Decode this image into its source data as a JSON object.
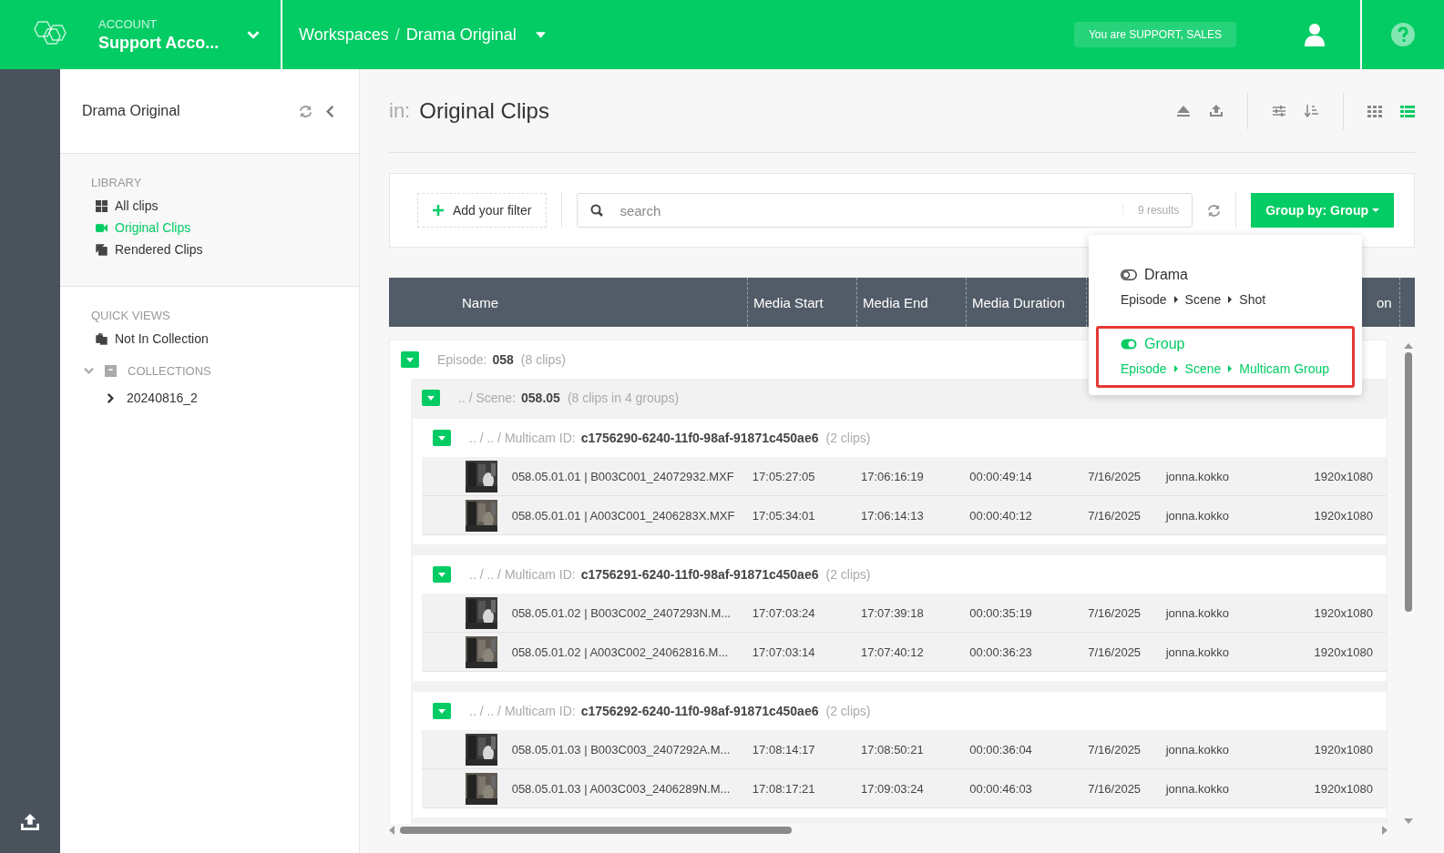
{
  "topbar": {
    "account_label": "ACCOUNT",
    "account_name": "Support Acco...",
    "breadcrumb": [
      "Workspaces",
      "Drama Original"
    ],
    "breadcrumb_separator": "/",
    "role_badge": "You are SUPPORT, SALES"
  },
  "sidebar": {
    "title": "Drama Original",
    "sections": [
      {
        "heading": "LIBRARY",
        "items": [
          {
            "label": "All clips",
            "kind": "grid",
            "selected": false
          },
          {
            "label": "Original Clips",
            "kind": "camera",
            "selected": true
          },
          {
            "label": "Rendered Clips",
            "kind": "copy",
            "selected": false
          }
        ]
      },
      {
        "heading": "QUICK VIEWS",
        "items": [
          {
            "label": "Not In Collection",
            "kind": "stack",
            "selected": false
          }
        ]
      }
    ],
    "collections": {
      "heading": "COLLECTIONS",
      "expanded": true,
      "children": [
        {
          "label": "20240816_2",
          "expanded": false
        }
      ]
    }
  },
  "main": {
    "prefix": "in:",
    "title": "Original Clips",
    "views": [
      {
        "kind": "grid",
        "selected": false
      },
      {
        "kind": "list",
        "selected": true
      }
    ]
  },
  "filter": {
    "add_button": "Add your filter",
    "search_placeholder": "search",
    "results": "9 results",
    "group_button": "Group by: Group"
  },
  "group_menu": [
    {
      "name": "Drama",
      "path": [
        "Episode",
        "Scene",
        "Shot"
      ],
      "selected": false
    },
    {
      "name": "Group",
      "path": [
        "Episode",
        "Scene",
        "Multicam Group"
      ],
      "selected": true
    }
  ],
  "table": {
    "columns": [
      "Name",
      "Media Start",
      "Media End",
      "Media Duration",
      "on"
    ],
    "episode": {
      "label": "Episode:",
      "value": "058",
      "count": "(8 clips)",
      "expanded": true,
      "scene": {
        "label": ".. / Scene:",
        "value": "058.05",
        "count": "(8 clips in 4 groups)",
        "expanded": true,
        "groups": [
          {
            "label": ".. / .. / Multicam ID:",
            "value": "c1756290-6240-11f0-98af-91871c450ae6",
            "count": "(2 clips)",
            "expanded": true,
            "clips": [
              [
                "058.05.01.01 | B003C001_24072932.MXF",
                "17:05:27:05",
                "17:06:16:19",
                "00:00:49:14",
                "7/16/2025",
                "jonna.kokko",
                "1920x1080"
              ],
              [
                "058.05.01.01 | A003C001_2406283X.MXF",
                "17:05:34:01",
                "17:06:14:13",
                "00:00:40:12",
                "7/16/2025",
                "jonna.kokko",
                "1920x1080"
              ]
            ]
          },
          {
            "label": ".. / .. / Multicam ID:",
            "value": "c1756291-6240-11f0-98af-91871c450ae6",
            "count": "(2 clips)",
            "expanded": true,
            "clips": [
              [
                "058.05.01.02 | B003C002_2407293N.M...",
                "17:07:03:24",
                "17:07:39:18",
                "00:00:35:19",
                "7/16/2025",
                "jonna.kokko",
                "1920x1080"
              ],
              [
                "058.05.01.02 | A003C002_24062816.M...",
                "17:07:03:14",
                "17:07:40:12",
                "00:00:36:23",
                "7/16/2025",
                "jonna.kokko",
                "1920x1080"
              ]
            ]
          },
          {
            "label": ".. / .. / Multicam ID:",
            "value": "c1756292-6240-11f0-98af-91871c450ae6",
            "count": "(2 clips)",
            "expanded": true,
            "clips": [
              [
                "058.05.01.03 | B003C003_2407292A.M...",
                "17:08:14:17",
                "17:08:50:21",
                "00:00:36:04",
                "7/16/2025",
                "jonna.kokko",
                "1920x1080"
              ],
              [
                "058.05.01.03 | A003C003_2406289N.M...",
                "17:08:17:21",
                "17:09:03:24",
                "00:00:46:03",
                "7/16/2025",
                "jonna.kokko",
                "1920x1080"
              ]
            ]
          }
        ]
      }
    }
  }
}
